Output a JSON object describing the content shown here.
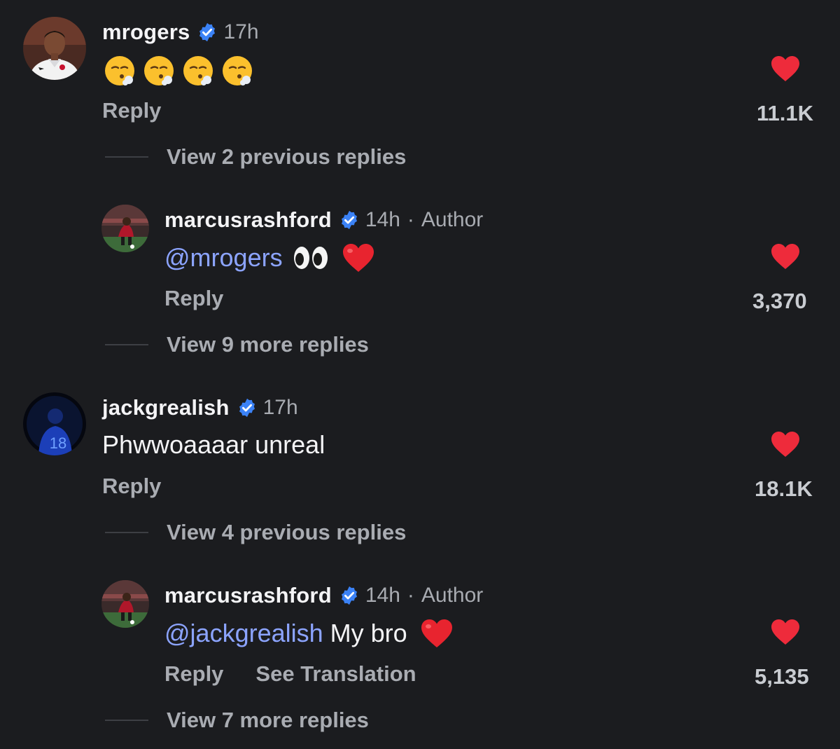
{
  "comments": [
    {
      "username": "mrogers",
      "time": "17h",
      "emoji_text": "😮‍💨😮‍💨😮‍💨😮‍💨",
      "reply_label": "Reply",
      "likes": "11.1K",
      "view_replies": "View 2 previous replies",
      "avatar_icon": "player-avatar-england-kit"
    },
    {
      "username": "marcusrashford",
      "time": "14h",
      "separator": "·",
      "author_label": "Author",
      "mention": "@mrogers",
      "emoji_text": "👀 ❤️",
      "reply_label": "Reply",
      "likes": "3,370",
      "view_replies": "View 9 more replies",
      "avatar_icon": "player-avatar-red-kit"
    },
    {
      "username": "jackgrealish",
      "time": "17h",
      "text": "Phwwoaaaar unreal",
      "reply_label": "Reply",
      "likes": "18.1K",
      "view_replies": "View 4 previous replies",
      "avatar_icon": "player-avatar-blue-18"
    },
    {
      "username": "marcusrashford",
      "time": "14h",
      "separator": "·",
      "author_label": "Author",
      "mention": "@jackgrealish",
      "text": " My bro",
      "emoji_text": "❤️",
      "reply_label": "Reply",
      "translation_label": "See Translation",
      "likes": "5,135",
      "view_replies": "View 7 more replies",
      "avatar_icon": "player-avatar-red-kit"
    }
  ],
  "colors": {
    "background": "#1b1c1f",
    "mention": "#8ca4ff",
    "verified": "#3b82f6",
    "heart": "#ee2b3b",
    "muted": "#a9acb2"
  }
}
